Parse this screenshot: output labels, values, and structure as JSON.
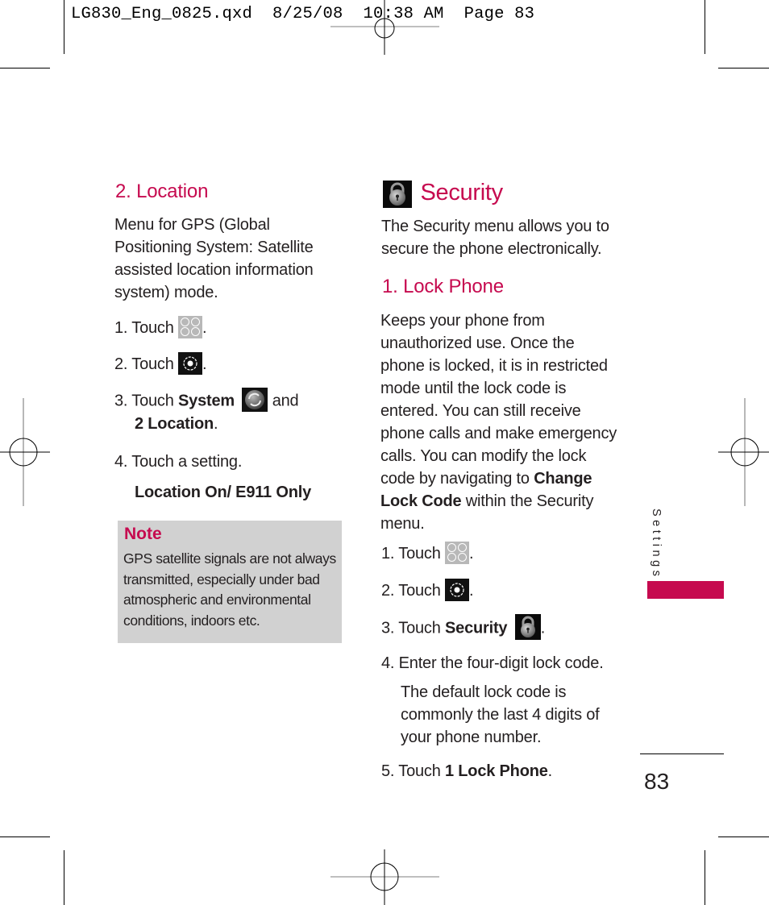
{
  "slug": {
    "text": "LG830_Eng_0825.qxd  8/25/08  10:38 AM  Page 83"
  },
  "left_column": {
    "heading": "2. Location",
    "intro": "Menu for GPS (Global Positioning System: Satellite assisted location information system) mode.",
    "intro_lines": [
      "Menu for GPS (Global",
      "Positioning System: Satellite",
      "assisted location information",
      "system) mode."
    ],
    "steps": [
      {
        "num": "1.",
        "text": "Touch",
        "icon": "menu-grid-icon",
        "after": "."
      },
      {
        "num": "2.",
        "text": "Touch",
        "icon": "settings-gear-icon",
        "after": "."
      },
      {
        "num": "3.",
        "text": "Touch",
        "bold": "System",
        "icon": "system-sync-icon",
        "after": " and",
        "line2_bold": "2 Location",
        "line2_after": "."
      },
      {
        "num": "4.",
        "text": "Touch a setting."
      }
    ],
    "setting_option": "Location On/ E911 Only",
    "note": {
      "title": "Note",
      "text": "GPS satellite signals are not always transmitted, especially under bad atmospheric and environmental conditions, indoors etc.",
      "lines": [
        "GPS satellite signals are not always",
        "transmitted, especially under bad",
        "atmospheric and environmental",
        "conditions, indoors etc."
      ]
    }
  },
  "right_column": {
    "title": "Security",
    "title_icon": "padlock-icon",
    "intro_lines": [
      "The Security menu allows you to",
      "secure the phone electronically."
    ],
    "subheading": "1. Lock Phone",
    "description_lines": [
      "Keeps your phone from",
      "unauthorized use. Once the",
      "phone is locked, it is in restricted",
      "mode until the lock code is",
      "entered. You can still receive",
      "phone calls and make emergency",
      "calls. You can modify the lock",
      "code by navigating to ",
      "Change",
      "Lock Code",
      " within the Security",
      "menu."
    ],
    "steps": [
      {
        "num": "1.",
        "text": "Touch",
        "icon": "menu-grid-icon",
        "after": "."
      },
      {
        "num": "2.",
        "text": "Touch",
        "icon": "settings-gear-icon",
        "after": "."
      },
      {
        "num": "3.",
        "text": "Touch",
        "bold": "Security",
        "icon": "padlock-icon",
        "after": "."
      },
      {
        "num": "4.",
        "text": "Enter the four-digit lock code."
      },
      {
        "num": "5.",
        "text": "Touch",
        "bold": "1 Lock Phone",
        "after": "."
      }
    ],
    "step4_detail_lines": [
      "The default lock code is",
      "commonly the last 4 digits of",
      "your phone number."
    ]
  },
  "sidebar": {
    "section_label": "Settings",
    "tab_color": "#c60a4f"
  },
  "footer": {
    "page_number": "83"
  },
  "colors": {
    "accent": "#c60a4f",
    "note_background": "#d1d1d1",
    "text": "#231f20"
  }
}
